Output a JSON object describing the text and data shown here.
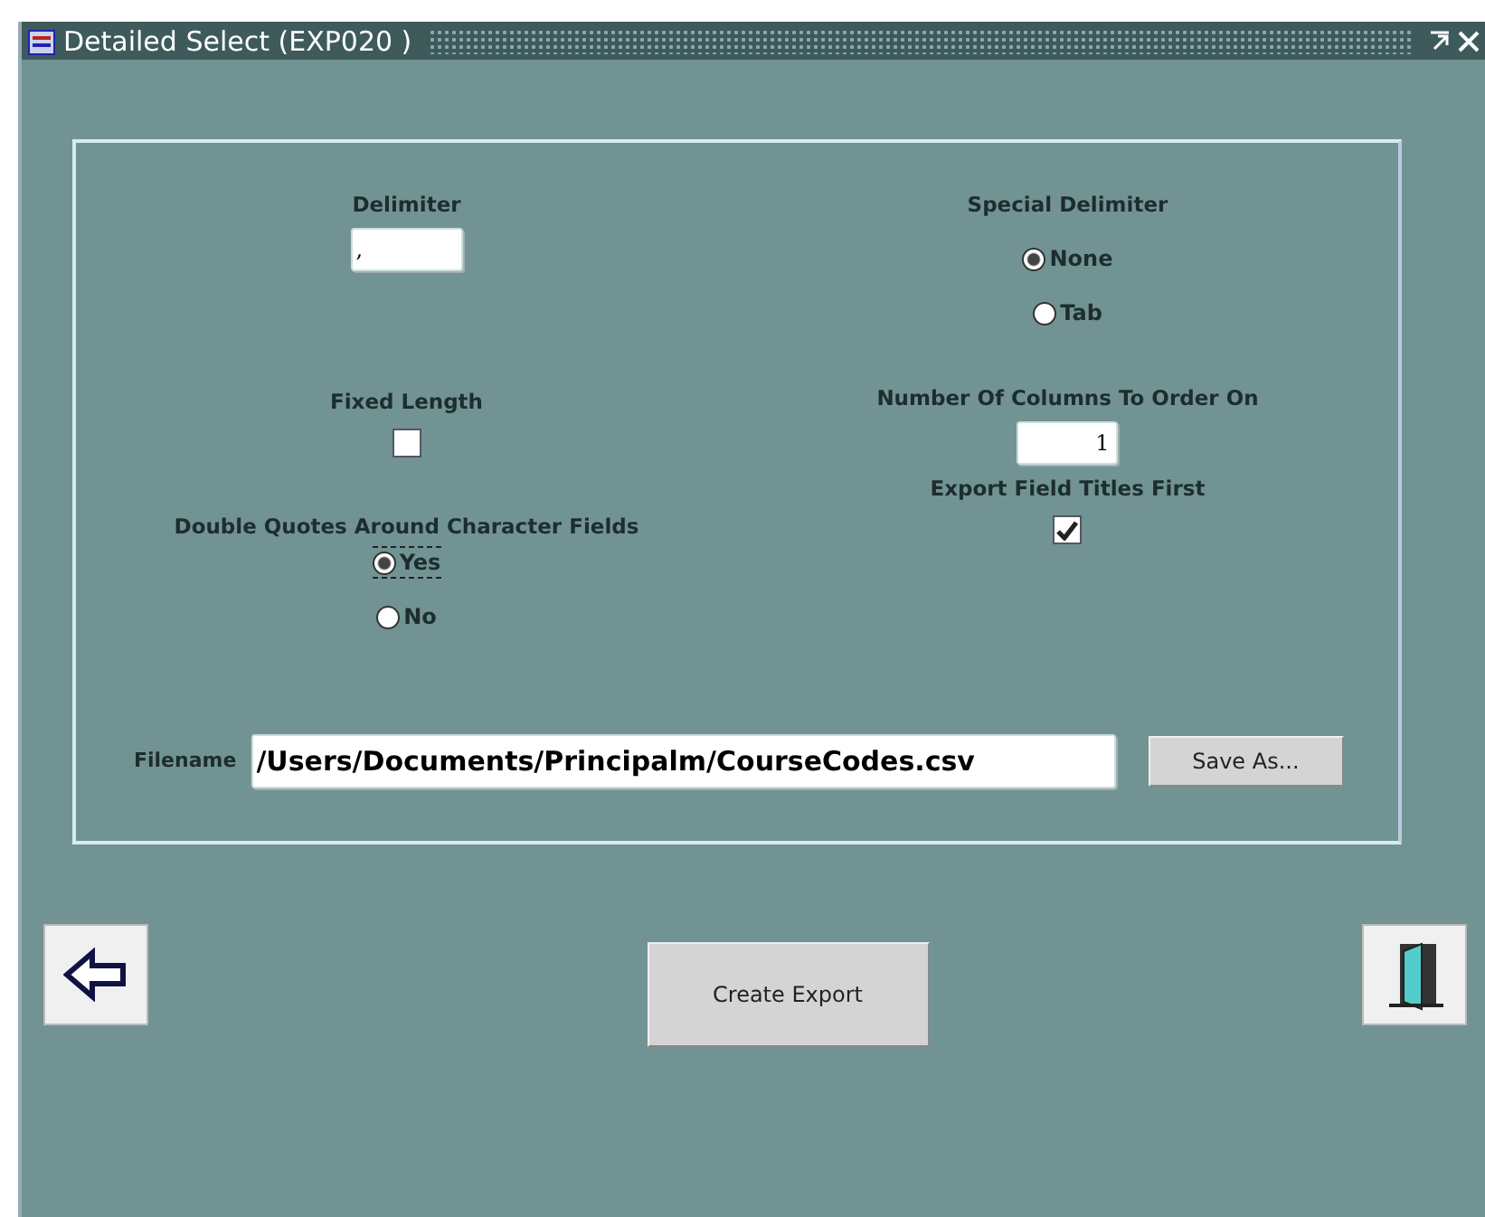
{
  "window": {
    "title": "Detailed Select (EXP020 )"
  },
  "delimiter": {
    "label": "Delimiter",
    "value": ","
  },
  "special_delimiter": {
    "label": "Special Delimiter",
    "options": [
      {
        "label": "None",
        "selected": true
      },
      {
        "label": "Tab",
        "selected": false
      }
    ]
  },
  "fixed_length": {
    "label": "Fixed Length",
    "checked": false
  },
  "order_columns": {
    "label": "Number Of Columns To Order On",
    "value": "1"
  },
  "double_quotes": {
    "label": "Double Quotes  Around Character Fields",
    "options": [
      {
        "label": "Yes",
        "selected": true
      },
      {
        "label": "No",
        "selected": false
      }
    ]
  },
  "export_titles": {
    "label": "Export Field Titles First",
    "checked": true
  },
  "filename": {
    "label": "Filename",
    "value": "/Users/Documents/Principalm/CourseCodes.csv"
  },
  "save_as": "Save As...",
  "create_export": "Create Export"
}
